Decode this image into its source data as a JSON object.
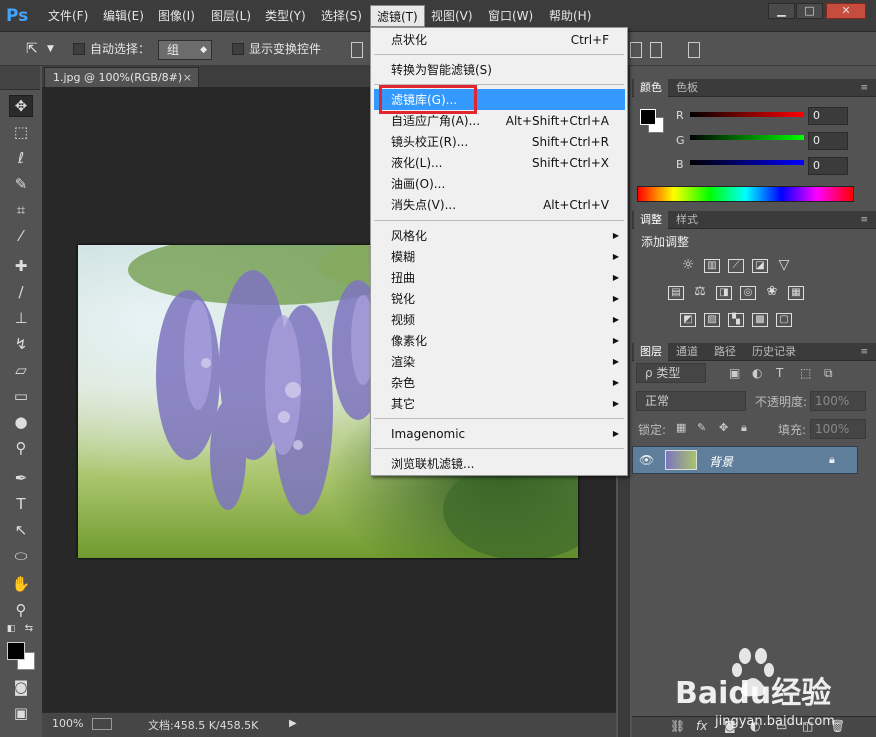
{
  "app": {
    "logo": "Ps"
  },
  "menubar": {
    "items": [
      "文件(F)",
      "编辑(E)",
      "图像(I)",
      "图层(L)",
      "类型(Y)",
      "选择(S)",
      "滤镜(T)",
      "视图(V)",
      "窗口(W)",
      "帮助(H)"
    ],
    "active": "滤镜(T)"
  },
  "window_controls": {
    "minimize": "▁",
    "maximize": "□",
    "close": "✕"
  },
  "options_bar": {
    "auto_select_label": "自动选择：",
    "auto_select_value": "组",
    "show_transform_label": "显示变换控件"
  },
  "document": {
    "tab_title": "1.jpg @ 100%(RGB/8#)",
    "tab_close": "×",
    "zoom": "100%",
    "doc_info": "文档:458.5 K/458.5K"
  },
  "filter_menu": {
    "items": [
      {
        "label": "点状化",
        "shortcut": "Ctrl+F"
      },
      {
        "label": "转换为智能滤镜(S)",
        "shortcut": ""
      },
      {
        "label": "滤镜库(G)...",
        "shortcut": "",
        "highlighted": true
      },
      {
        "label": "自适应广角(A)...",
        "shortcut": "Alt+Shift+Ctrl+A"
      },
      {
        "label": "镜头校正(R)...",
        "shortcut": "Shift+Ctrl+R"
      },
      {
        "label": "液化(L)...",
        "shortcut": "Shift+Ctrl+X"
      },
      {
        "label": "油画(O)...",
        "shortcut": ""
      },
      {
        "label": "消失点(V)...",
        "shortcut": "Alt+Ctrl+V"
      },
      {
        "label": "风格化",
        "submenu": true
      },
      {
        "label": "模糊",
        "submenu": true
      },
      {
        "label": "扭曲",
        "submenu": true
      },
      {
        "label": "锐化",
        "submenu": true
      },
      {
        "label": "视频",
        "submenu": true
      },
      {
        "label": "像素化",
        "submenu": true
      },
      {
        "label": "渲染",
        "submenu": true
      },
      {
        "label": "杂色",
        "submenu": true
      },
      {
        "label": "其它",
        "submenu": true
      },
      {
        "label": "Imagenomic",
        "submenu": true
      },
      {
        "label": "浏览联机滤镜...",
        "shortcut": ""
      }
    ],
    "submenu_arrow": "▶"
  },
  "color_panel": {
    "tabs": [
      "颜色",
      "色板"
    ],
    "channels": [
      {
        "label": "R",
        "value": "0"
      },
      {
        "label": "G",
        "value": "0"
      },
      {
        "label": "B",
        "value": "0"
      }
    ]
  },
  "adjust_panel": {
    "tabs": [
      "调整",
      "样式"
    ],
    "heading": "添加调整"
  },
  "layers_panel": {
    "tabs": [
      "图层",
      "通道",
      "路径",
      "历史记录"
    ],
    "filter_label": "ρ 类型",
    "blend_mode": "正常",
    "opacity_label": "不透明度:",
    "opacity_value": "100%",
    "lock_label": "锁定:",
    "fill_label": "填充:",
    "fill_value": "100%",
    "layer_name": "背景"
  },
  "watermark": {
    "brand": "Baidu经验",
    "url": "jingyan.baidu.com"
  },
  "colors": {
    "menu_highlight": "#3399ff",
    "red_box": "#e0262e",
    "ps_blue": "#41a4ff"
  }
}
